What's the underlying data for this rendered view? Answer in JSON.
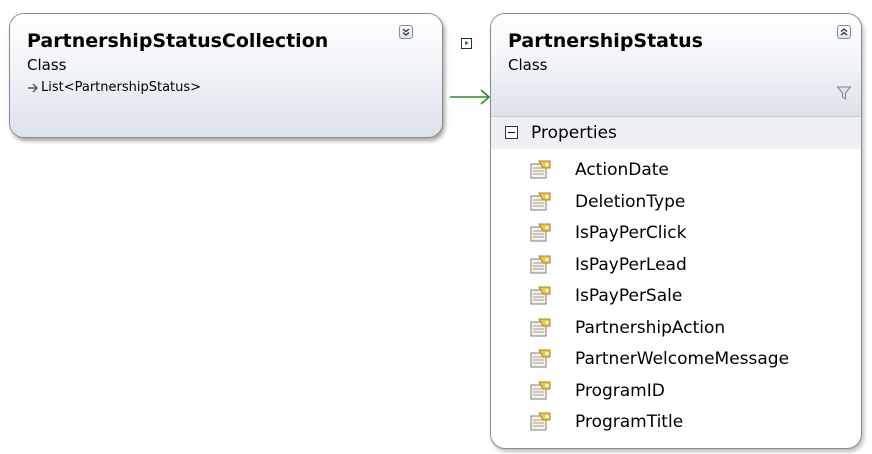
{
  "collection_class": {
    "name": "PartnershipStatusCollection",
    "kind": "Class",
    "inherits": "List<PartnershipStatus>",
    "collapse_icon": "chevron-double-down-icon"
  },
  "status_class": {
    "name": "PartnershipStatus",
    "kind": "Class",
    "collapse_icon": "chevron-double-up-icon",
    "filter_icon": "funnel-icon",
    "compartment": {
      "label": "Properties",
      "items": [
        "ActionDate",
        "DeletionType",
        "IsPayPerClick",
        "IsPayPerLead",
        "IsPayPerSale",
        "PartnershipAction",
        "PartnerWelcomeMessage",
        "ProgramID",
        "ProgramTitle"
      ]
    }
  },
  "colors": {
    "connector": "#2e8b2e",
    "border": "#8c8c8c"
  }
}
